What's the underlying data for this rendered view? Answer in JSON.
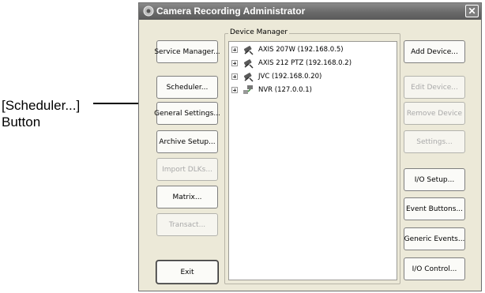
{
  "callout": {
    "line1": "[Scheduler...]",
    "line2": "Button"
  },
  "window": {
    "title": "Camera Recording Administrator",
    "close_glyph": "✕"
  },
  "left_buttons": {
    "service_manager": "Service Manager...",
    "scheduler": "Scheduler...",
    "general_settings": "General Settings...",
    "archive_setup": "Archive Setup...",
    "import_dlks": "Import DLKs...",
    "matrix": "Matrix...",
    "transact": "Transact...",
    "exit": "Exit"
  },
  "device_manager": {
    "label": "Device Manager",
    "devices": [
      {
        "label": "AXIS 207W (192.168.0.5)",
        "icon": "camera-icon"
      },
      {
        "label": "AXIS 212 PTZ (192.168.0.2)",
        "icon": "camera-icon"
      },
      {
        "label": "JVC (192.168.0.20)",
        "icon": "camera-icon"
      },
      {
        "label": "NVR (127.0.0.1)",
        "icon": "nvr-icon"
      }
    ]
  },
  "right_buttons": {
    "add_device": "Add Device...",
    "edit_device": "Edit Device...",
    "remove_device": "Remove Device",
    "settings": "Settings...",
    "io_setup": "I/O Setup...",
    "event_buttons": "Event Buttons...",
    "generic_events": "Generic Events...",
    "io_control": "I/O Control..."
  },
  "colors": {
    "window_bg": "#ece9d8",
    "titlebar": "#6a6a6a",
    "disabled_text": "#a9a9a9"
  }
}
